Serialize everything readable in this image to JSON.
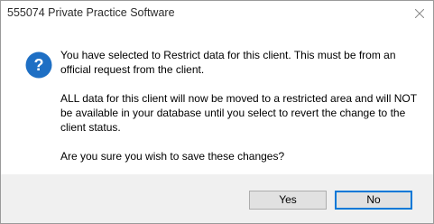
{
  "window": {
    "title": "555074 Private Practice Software",
    "close_icon": "close-icon"
  },
  "dialog": {
    "icon": "question-icon",
    "icon_color": "#1e6fc4",
    "paragraphs": [
      "You have selected to Restrict data for this client. This must be from an official request from the client.",
      "ALL data for this client will now be moved to a restricted area and will NOT be available in your database until you select to revert the change to the client status.",
      "Are you sure you wish to save these changes?"
    ]
  },
  "buttons": {
    "yes_label": "Yes",
    "no_label": "No",
    "focus_color": "#0078d7"
  }
}
